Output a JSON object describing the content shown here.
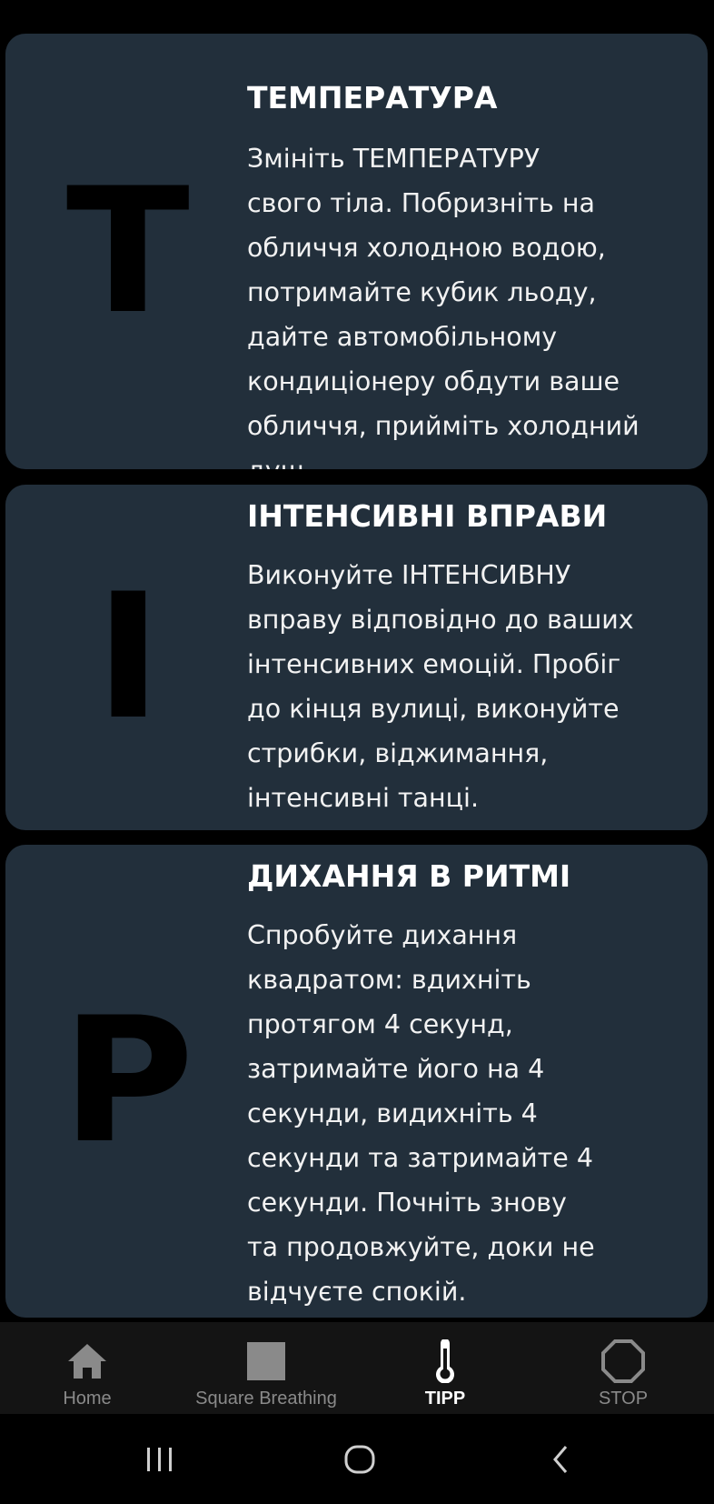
{
  "cards": [
    {
      "letter": "T",
      "title": "ТЕМПЕРАТУРА",
      "body": "Змініть ТЕМПЕРАТУРУ\nсвого тіла. Побризніть на\nобличчя холодною водою,\nпотримайте кубик льоду,\nдайте автомобільному\nкондиціонеру обдути ваше\nобличчя, прийміть холодний\nдуш."
    },
    {
      "letter": "I",
      "title": "ІНТЕНСИВНІ ВПРАВИ",
      "body": "Виконуйте ІНТЕНСИВНУ\nвправу відповідно до ваших\nінтенсивних емоцій. Пробіг\nдо кінця вулиці, виконуйте\nстрибки, віджимання,\nінтенсивні танці."
    },
    {
      "letter": "P",
      "title": "ДИХАННЯ В РИТМІ",
      "body": "Спробуйте дихання\nквадратом: вдихніть\nпротягом 4 секунд,\nзатримайте його на 4\nсекунди, видихніть 4\nсекунди та затримайте 4\nсекунди. Почніть знову\nта продовжуйте, доки не\nвідчуєте спокій."
    }
  ],
  "nav": {
    "items": [
      {
        "label": "Home",
        "icon": "home-icon"
      },
      {
        "label": "Square Breathing",
        "icon": "square-icon"
      },
      {
        "label": "TIPP",
        "icon": "thermometer-icon",
        "active": true
      },
      {
        "label": "STOP",
        "icon": "octagon-icon"
      }
    ]
  },
  "system_nav": {
    "buttons": [
      "recent-apps-icon",
      "home-circle-icon",
      "back-icon"
    ]
  },
  "colors": {
    "background": "#000000",
    "card": "#222f3b",
    "nav_bar": "#141414",
    "nav_inactive": "#8a8a8a",
    "nav_active": "#ffffff"
  }
}
